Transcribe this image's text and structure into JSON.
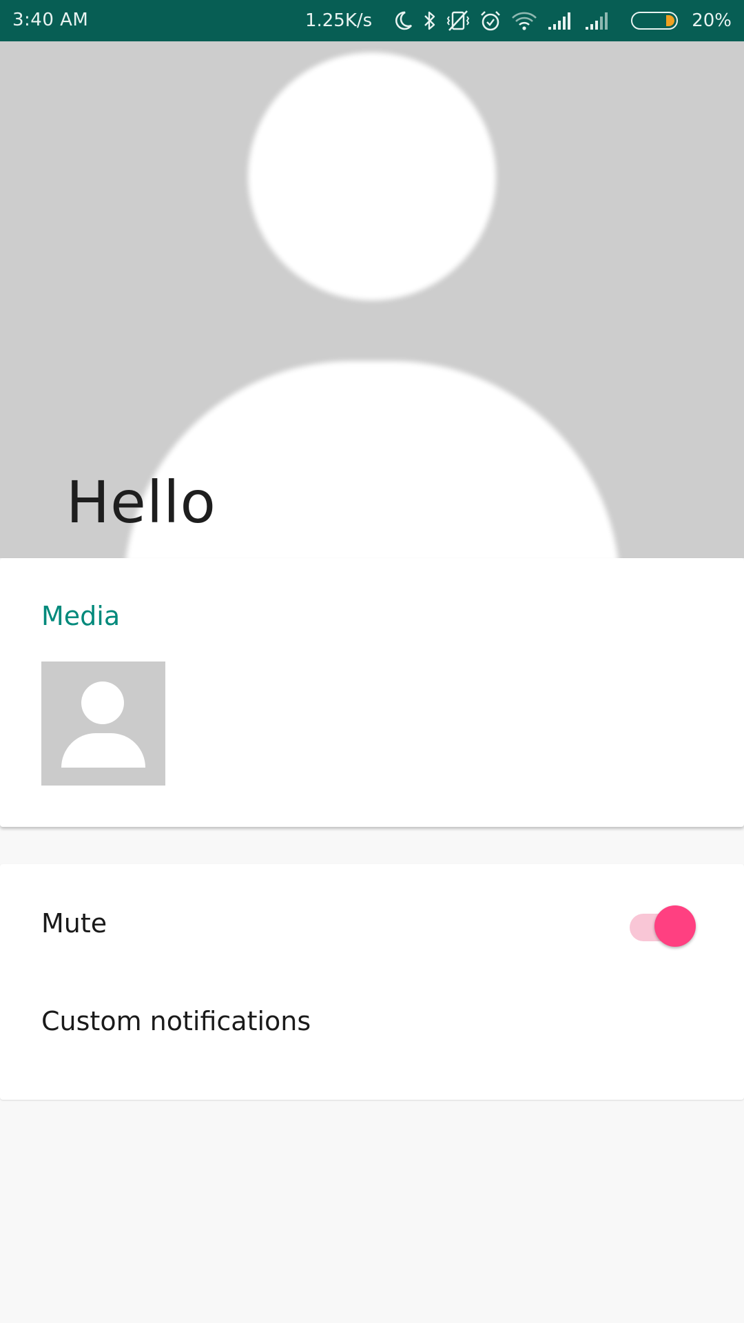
{
  "status_bar": {
    "time": "3:40 AM",
    "network_speed": "1.25K/s",
    "battery_percent": "20%",
    "battery_level": 0.2,
    "icons": [
      "moon-icon",
      "bluetooth-icon",
      "vibrate-off-icon",
      "alarm-icon",
      "wifi-icon",
      "signal-icon",
      "signal-icon-2",
      "battery-icon"
    ],
    "background_color": "#075e54"
  },
  "header": {
    "title": "Hello",
    "background_color": "#cdcdcd"
  },
  "media": {
    "title": "Media",
    "title_color": "#00897b",
    "items": [
      {
        "icon": "default-avatar-icon"
      }
    ]
  },
  "settings": {
    "mute": {
      "label": "Mute",
      "enabled": true,
      "accent_color": "#ff4081"
    },
    "custom_notifications": {
      "label": "Custom notifications"
    }
  }
}
